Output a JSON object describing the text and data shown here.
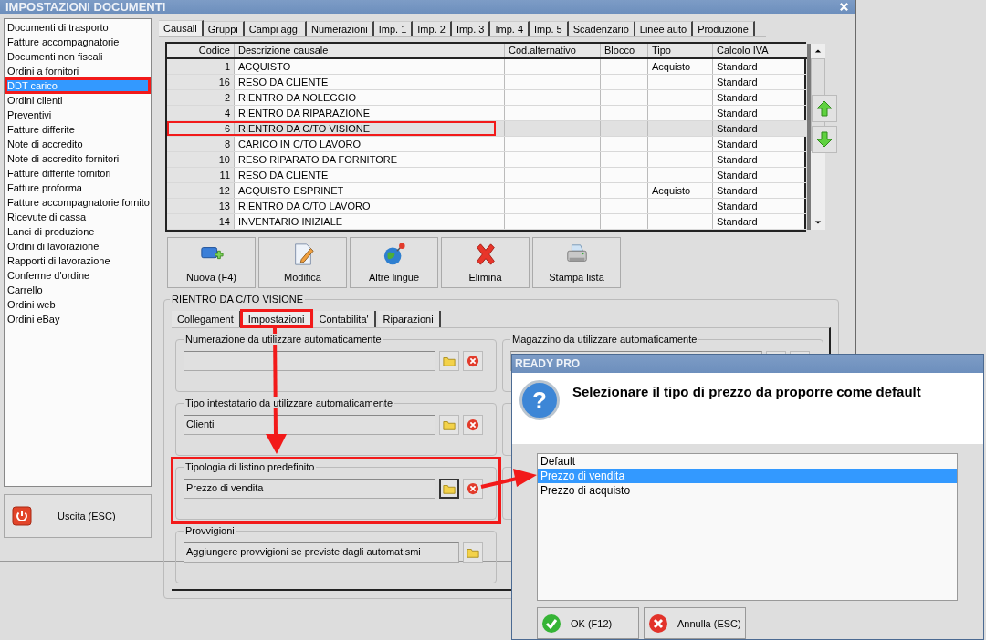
{
  "window": {
    "title": "IMPOSTAZIONI DOCUMENTI"
  },
  "document_types": [
    {
      "label": "Documenti di trasporto",
      "selected": false
    },
    {
      "label": "Fatture accompagnatorie",
      "selected": false
    },
    {
      "label": "Documenti non fiscali",
      "selected": false
    },
    {
      "label": "Ordini a fornitori",
      "selected": false
    },
    {
      "label": "DDT carico",
      "selected": true
    },
    {
      "label": "Ordini clienti",
      "selected": false
    },
    {
      "label": "Preventivi",
      "selected": false
    },
    {
      "label": "Fatture differite",
      "selected": false
    },
    {
      "label": "Note di accredito",
      "selected": false
    },
    {
      "label": "Note di accredito fornitori",
      "selected": false
    },
    {
      "label": "Fatture differite fornitori",
      "selected": false
    },
    {
      "label": "Fatture proforma",
      "selected": false
    },
    {
      "label": "Fatture accompagnatorie fornito",
      "selected": false
    },
    {
      "label": "Ricevute di cassa",
      "selected": false
    },
    {
      "label": "Lanci di produzione",
      "selected": false
    },
    {
      "label": "Ordini di lavorazione",
      "selected": false
    },
    {
      "label": "Rapporti di lavorazione",
      "selected": false
    },
    {
      "label": "Conferme d'ordine",
      "selected": false
    },
    {
      "label": "Carrello",
      "selected": false
    },
    {
      "label": "Ordini web",
      "selected": false
    },
    {
      "label": "Ordini eBay",
      "selected": false
    }
  ],
  "exit_button": {
    "label": "Uscita (ESC)"
  },
  "tabs": [
    {
      "label": "Causali",
      "selected": true
    },
    {
      "label": "Gruppi",
      "selected": false
    },
    {
      "label": "Campi agg.",
      "selected": false
    },
    {
      "label": "Numerazioni",
      "selected": false
    },
    {
      "label": "Imp. 1",
      "selected": false
    },
    {
      "label": "Imp. 2",
      "selected": false
    },
    {
      "label": "Imp. 3",
      "selected": false
    },
    {
      "label": "Imp. 4",
      "selected": false
    },
    {
      "label": "Imp. 5",
      "selected": false
    },
    {
      "label": "Scadenzario",
      "selected": false
    },
    {
      "label": "Linee auto",
      "selected": false
    },
    {
      "label": "Produzione",
      "selected": false
    }
  ],
  "table": {
    "columns": [
      "Codice",
      "Descrizione causale",
      "Cod.alternativo",
      "Blocco",
      "Tipo",
      "Calcolo IVA"
    ],
    "rows": [
      {
        "cells": [
          "1",
          "ACQUISTO",
          "",
          "",
          "Acquisto",
          "Standard"
        ],
        "selected": false
      },
      {
        "cells": [
          "16",
          "RESO DA CLIENTE",
          "",
          "",
          "",
          "Standard"
        ],
        "selected": false
      },
      {
        "cells": [
          "2",
          "RIENTRO DA NOLEGGIO",
          "",
          "",
          "",
          "Standard"
        ],
        "selected": false
      },
      {
        "cells": [
          "4",
          "RIENTRO DA RIPARAZIONE",
          "",
          "",
          "",
          "Standard"
        ],
        "selected": false
      },
      {
        "cells": [
          "6",
          "RIENTRO DA C/TO VISIONE",
          "",
          "",
          "",
          "Standard"
        ],
        "selected": true
      },
      {
        "cells": [
          "8",
          "CARICO IN C/TO LAVORO",
          "",
          "",
          "",
          "Standard"
        ],
        "selected": false
      },
      {
        "cells": [
          "10",
          "RESO RIPARATO DA FORNITORE",
          "",
          "",
          "",
          "Standard"
        ],
        "selected": false
      },
      {
        "cells": [
          "11",
          "RESO DA CLIENTE",
          "",
          "",
          "",
          "Standard"
        ],
        "selected": false
      },
      {
        "cells": [
          "12",
          "ACQUISTO ESPRINET",
          "",
          "",
          "Acquisto",
          "Standard"
        ],
        "selected": false
      },
      {
        "cells": [
          "13",
          "RIENTRO DA C/TO LAVORO",
          "",
          "",
          "",
          "Standard"
        ],
        "selected": false
      },
      {
        "cells": [
          "14",
          "INVENTARIO INIZIALE",
          "",
          "",
          "",
          "Standard"
        ],
        "selected": false
      }
    ]
  },
  "actions": [
    {
      "label": "Nuova (F4)",
      "kind": "new"
    },
    {
      "label": "Modifica",
      "kind": "edit"
    },
    {
      "label": "Altre lingue",
      "kind": "languages"
    },
    {
      "label": "Elimina",
      "kind": "delete"
    },
    {
      "label": "Stampa lista",
      "kind": "print"
    }
  ],
  "detail": {
    "title": "RIENTRO DA C/TO VISIONE",
    "tabs": [
      {
        "label": "Collegament",
        "selected": false
      },
      {
        "label": "Impostazioni",
        "selected": true
      },
      {
        "label": "Contabilita'",
        "selected": false
      },
      {
        "label": "Riparazioni",
        "selected": false
      }
    ],
    "fields": [
      {
        "label": "Numerazione da utilizzare automaticamente",
        "clearable": true,
        "focused": false
      },
      {
        "label": "Tipo intestatario da utilizzare automaticamente",
        "value": "Clienti",
        "clearable": true,
        "focused": false
      },
      {
        "label": "Tipologia di listino predefinito",
        "value": "Prezzo di vendita",
        "clearable": true,
        "focused": true
      },
      {
        "label": "Provvigioni",
        "value": "Aggiungere provvigioni se previste dagli automatismi",
        "clearable": false,
        "focused": false
      }
    ],
    "right_fields": [
      {
        "label": "Magazzino da utilizzare automaticamente"
      }
    ]
  },
  "dialog": {
    "title": "READY PRO",
    "icon_glyph": "?",
    "message": "Selezionare il tipo di prezzo da proporre come default",
    "options": [
      {
        "label": "Default",
        "selected": false
      },
      {
        "label": "Prezzo di vendita",
        "selected": true
      },
      {
        "label": "Prezzo di acquisto",
        "selected": false
      }
    ],
    "buttons": [
      {
        "label": "OK (F12)",
        "kind": "ok"
      },
      {
        "label": "Annulla (ESC)",
        "kind": "cancel"
      }
    ]
  }
}
